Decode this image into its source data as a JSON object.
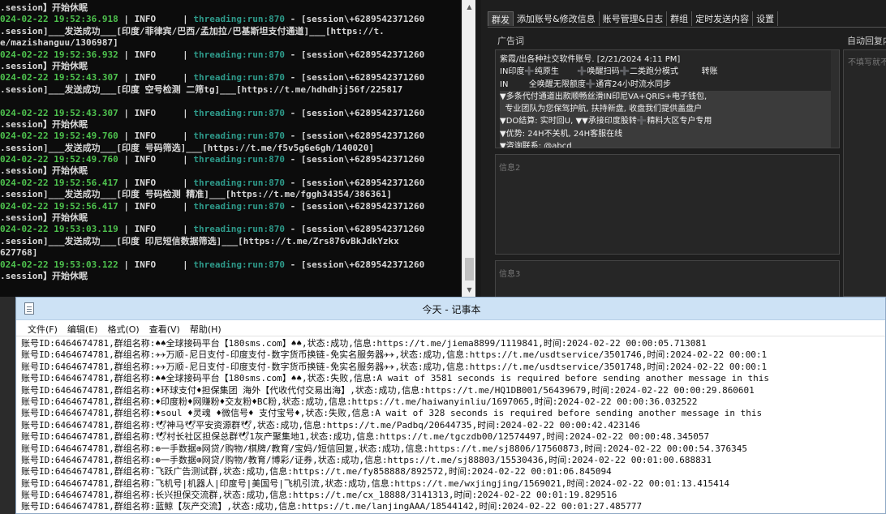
{
  "console": {
    "lines": [
      {
        "ts": "",
        "lvl": "",
        "thr": "",
        "rest": ".session】开始休眠"
      },
      {
        "ts": "024-02-22 19:52:36.918",
        "lvl": " | INFO     | ",
        "thr": "threading:run:870",
        "rest": " - [session\\+6289542371260"
      },
      {
        "ts": "",
        "lvl": "",
        "thr": "",
        "rest": ".session]___发送成功___[印度/菲律宾/巴西/孟加拉/巴基斯坦支付通道]___[https://t."
      },
      {
        "ts": "",
        "lvl": "",
        "thr": "",
        "rest": "e/mazishanguu/1306987]"
      },
      {
        "ts": "024-02-22 19:52:36.932",
        "lvl": " | INFO     | ",
        "thr": "threading:run:870",
        "rest": " - [session\\+6289542371260"
      },
      {
        "ts": "",
        "lvl": "",
        "thr": "",
        "rest": ".session】开始休眠"
      },
      {
        "ts": "024-02-22 19:52:43.307",
        "lvl": " | INFO     | ",
        "thr": "threading:run:870",
        "rest": " - [session\\+6289542371260"
      },
      {
        "ts": "",
        "lvl": "",
        "thr": "",
        "rest": ".session]___发送成功___[印度 空号检测 二筛tg]___[https://t.me/hdhdhjj56f/225817"
      },
      {
        "ts": "",
        "lvl": "",
        "thr": "",
        "rest": ""
      },
      {
        "ts": "024-02-22 19:52:43.307",
        "lvl": " | INFO     | ",
        "thr": "threading:run:870",
        "rest": " - [session\\+6289542371260"
      },
      {
        "ts": "",
        "lvl": "",
        "thr": "",
        "rest": ".session】开始休眠"
      },
      {
        "ts": "024-02-22 19:52:49.760",
        "lvl": " | INFO     | ",
        "thr": "threading:run:870",
        "rest": " - [session\\+6289542371260"
      },
      {
        "ts": "",
        "lvl": "",
        "thr": "",
        "rest": ".session]___发送成功___[印度 号码筛选]___[https://t.me/f5v5g6e6gh/140020]"
      },
      {
        "ts": "024-02-22 19:52:49.760",
        "lvl": " | INFO     | ",
        "thr": "threading:run:870",
        "rest": " - [session\\+6289542371260"
      },
      {
        "ts": "",
        "lvl": "",
        "thr": "",
        "rest": ".session】开始休眠"
      },
      {
        "ts": "024-02-22 19:52:56.417",
        "lvl": " | INFO     | ",
        "thr": "threading:run:870",
        "rest": " - [session\\+6289542371260"
      },
      {
        "ts": "",
        "lvl": "",
        "thr": "",
        "rest": ".session]___发送成功___[印度 号码检测 精准]___[https://t.me/fggh34354/386361]"
      },
      {
        "ts": "024-02-22 19:52:56.417",
        "lvl": " | INFO     | ",
        "thr": "threading:run:870",
        "rest": " - [session\\+6289542371260"
      },
      {
        "ts": "",
        "lvl": "",
        "thr": "",
        "rest": ".session】开始休眠"
      },
      {
        "ts": "024-02-22 19:53:03.119",
        "lvl": " | INFO     | ",
        "thr": "threading:run:870",
        "rest": " - [session\\+6289542371260"
      },
      {
        "ts": "",
        "lvl": "",
        "thr": "",
        "rest": ".session]___发送成功___[印度 印尼短信数据筛选]___[https://t.me/Zrs876vBkJdkYzkx"
      },
      {
        "ts": "",
        "lvl": "",
        "thr": "",
        "rest": "627768]"
      },
      {
        "ts": "024-02-22 19:53:03.122",
        "lvl": " | INFO     | ",
        "thr": "threading:run:870",
        "rest": " - [session\\+6289542371260"
      },
      {
        "ts": "",
        "lvl": "",
        "thr": "",
        "rest": ".session】开始休眠"
      }
    ]
  },
  "app": {
    "tabs": [
      "群发",
      "添加账号&修改信息",
      "账号管理&日志",
      "群组",
      "定时发送内容",
      "设置"
    ],
    "ad_label": "广告词",
    "auto_reply_label": "自动回复内",
    "auto_reply_placeholder": "不填写就不",
    "ad_text": [
      "紫霞/出各种社交软件账号. [2/21/2024 4:11 PM]",
      "IN印度➕纯原生       ➕唤醒扫码➕二类跑分模式         转账",
      "IN        全唤醒无限额度➕通宵24小时流水同步",
      "▼多条代付通道出款顺畅丝滑IN印尼VA+QRIS+电子钱包,",
      "  专业团队为您保驾护航, 扶持新盘, 收盘我们提供盖盘户",
      "▼DO结算: 实时回U, ▼▼承接印度股转➕精料大区专户专用",
      "▼优势: 24H不关机, 24H客服在线",
      "▼咨询联系: @abcd"
    ],
    "info2_placeholder": "信息2",
    "info3_placeholder": "信息3"
  },
  "notepad": {
    "title": "今天 - 记事本",
    "menu": [
      "文件(F)",
      "编辑(E)",
      "格式(O)",
      "查看(V)",
      "帮助(H)"
    ],
    "lines": [
      "账号ID:6464674781,群组名称:♠♠全球接码平台【180sms.com】♠♠,状态:成功,信息:https://t.me/jiema8899/1119841,时间:2024-02-22 00:00:05.713081",
      "账号ID:6464674781,群组名称:✈✈万顺-尼日支付-印度支付-数字货币换链-免实名服务器✈✈,状态:成功,信息:https://t.me/usdtservice/3501746,时间:2024-02-22 00:00:1",
      "账号ID:6464674781,群组名称:✈✈万顺-尼日支付-印度支付-数字货币换链-免实名服务器✈✈,状态:成功,信息:https://t.me/usdtservice/3501748,时间:2024-02-22 00:00:1",
      "账号ID:6464674781,群组名称:♠♠全球接码平台【180sms.com】♠♠,状态:失败,信息:A wait of 3581 seconds is required before sending another message in this",
      "账号ID:6464674781,群组名称:♦环球支付♦担保集团 海外【代收代付交易出海】,状态:成功,信息:https://t.me/HQ1DB001/56439679,时间:2024-02-22 00:00:29.860601",
      "账号ID:6464674781,群组名称:♦印度粉♦网赚粉♦交友粉♦BC粉,状态:成功,信息:https://t.me/haiwanyinliu/1697065,时间:2024-02-22 00:00:36.032522",
      "账号ID:6464674781,群组名称:♦soul ♦灵魂 ♦微信号♦ 支付宝号♦,状态:失败,信息:A wait of 328 seconds is required before sending another message in this",
      "账号ID:6464674781,群组名称:🕊神马🕊平安资源群🕊,状态:成功,信息:https://t.me/Padbq/20644735,时间:2024-02-22 00:00:42.423146",
      "账号ID:6464674781,群组名称:🕊村长社区担保总群🕊1灰产聚集地1,状态:成功,信息:https://t.me/tgczdb00/12574497,时间:2024-02-22 00:00:48.345057",
      "账号ID:6464674781,群组名称:⊕一手数据⊕网贷/购物/棋牌/教育/宝妈/短信回复,状态:成功,信息:https://t.me/sj8806/17560873,时间:2024-02-22 00:00:54.376345",
      "账号ID:6464674781,群组名称:⊕一手数据⊕网贷/购物/教育/博彩/证券,状态:成功,信息:https://t.me/sj88803/15530436,时间:2024-02-22 00:01:00.688831",
      "账号ID:6464674781,群组名称:飞跃广告测试群,状态:成功,信息:https://t.me/fy858888/892572,时间:2024-02-22 00:01:06.845094",
      "账号ID:6464674781,群组名称:飞机号|机器人|印度号|美国号|飞机引流,状态:成功,信息:https://t.me/wxjingjing/1569021,时间:2024-02-22 00:01:13.415414",
      "账号ID:6464674781,群组名称:长兴担保交流群,状态:成功,信息:https://t.me/cx_18888/3141313,时间:2024-02-22 00:01:19.829516",
      "账号ID:6464674781,群组名称:蓝鲸【灰产交流】,状态:成功,信息:https://t.me/lanjingAAA/18544142,时间:2024-02-22 00:01:27.485777"
    ]
  }
}
